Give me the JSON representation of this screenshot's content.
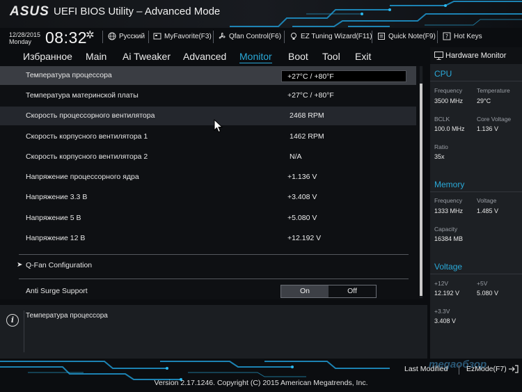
{
  "header": {
    "logo": "ASUS",
    "title": "UEFI BIOS Utility – Advanced Mode"
  },
  "infobar": {
    "date": "12/28/2015",
    "day": "Monday",
    "time": "08:32",
    "time_icon": "gear-icon",
    "tools": [
      {
        "label": "Русский",
        "icon": "globe-icon"
      },
      {
        "label": "MyFavorite(F3)",
        "icon": "favorite-icon"
      },
      {
        "label": "Qfan Control(F6)",
        "icon": "fan-icon"
      },
      {
        "label": "EZ Tuning Wizard(F11)",
        "icon": "bulb-icon"
      },
      {
        "label": "Quick Note(F9)",
        "icon": "note-icon"
      },
      {
        "label": "Hot Keys",
        "icon": "question-icon"
      }
    ]
  },
  "tabs": [
    {
      "label": "Избранное",
      "active": false
    },
    {
      "label": "Main",
      "active": false
    },
    {
      "label": "Ai Tweaker",
      "active": false
    },
    {
      "label": "Advanced",
      "active": false
    },
    {
      "label": "Monitor",
      "active": true
    },
    {
      "label": "Boot",
      "active": false
    },
    {
      "label": "Tool",
      "active": false
    },
    {
      "label": "Exit",
      "active": false
    }
  ],
  "settings": [
    {
      "label": "Температура процессора",
      "value": "+27°C / +80°F"
    },
    {
      "label": "Температура материнской платы",
      "value": "+27°C / +80°F"
    },
    {
      "label": "Скорость процессорного вентилятора",
      "value": "2468 RPM"
    },
    {
      "label": "Скорость корпусного вентилятора 1",
      "value": "1462 RPM"
    },
    {
      "label": "Скорость корпусного вентилятора 2",
      "value": "N/A"
    },
    {
      "label": "Напряжение процессорного ядра",
      "value": "+1.136 V"
    },
    {
      "label": "Напряжение 3.3 В",
      "value": "+3.408 V"
    },
    {
      "label": "Напряжение 5 В",
      "value": "+5.080 V"
    },
    {
      "label": "Напряжение 12 В",
      "value": "+12.192 V"
    }
  ],
  "submenu": {
    "label": "Q-Fan Configuration"
  },
  "anti_surge": {
    "label": "Anti Surge Support",
    "on": "On",
    "off": "Off",
    "selected": "On"
  },
  "help": {
    "text": "Температура процессора"
  },
  "hw_monitor": {
    "title": "Hardware Monitor",
    "cpu": {
      "title": "CPU",
      "frequency_label": "Frequency",
      "frequency": "3500 MHz",
      "temperature_label": "Temperature",
      "temperature": "29°C",
      "bclk_label": "BCLK",
      "bclk": "100.0 MHz",
      "core_voltage_label": "Core Voltage",
      "core_voltage": "1.136 V",
      "ratio_label": "Ratio",
      "ratio": "35x"
    },
    "memory": {
      "title": "Memory",
      "frequency_label": "Frequency",
      "frequency": "1333 MHz",
      "voltage_label": "Voltage",
      "voltage": "1.485 V",
      "capacity_label": "Capacity",
      "capacity": "16384 MB"
    },
    "voltage": {
      "title": "Voltage",
      "v12_label": "+12V",
      "v12": "12.192 V",
      "v5_label": "+5V",
      "v5": "5.080 V",
      "v33_label": "+3.3V",
      "v33": "3.408 V"
    }
  },
  "footer": {
    "last_modified": "Last Modified",
    "ezmode": "EzMode(F7)",
    "watermark": "megaобзор",
    "version": "Version 2.17.1246. Copyright (C) 2015 American Megatrends, Inc."
  },
  "colors": {
    "accent": "#2aa9d8",
    "background": "#0b0d10"
  }
}
